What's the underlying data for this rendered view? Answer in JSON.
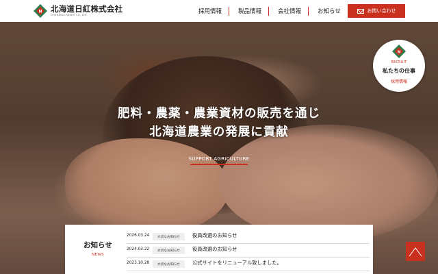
{
  "header": {
    "company_name": "北海道日紅株式会社",
    "company_sub": "HOKKAIDO NIKKO CO.,Ltd.",
    "nav": [
      {
        "label": "採用情報"
      },
      {
        "label": "製品情報"
      },
      {
        "label": "会社情報"
      },
      {
        "label": "お知らせ"
      }
    ],
    "contact_label": "お問い合わせ",
    "accent_color": "#c9301f"
  },
  "hero": {
    "catch_line1": "肥料・農薬・農業資材の販売を通じ",
    "catch_line2": "北海道農業の発展に貢献",
    "support_label": "SUPPORT AGRICULTURE"
  },
  "recruit": {
    "label": "RECRUIT",
    "title": "私たちの仕事",
    "sub": "採用情報"
  },
  "news": {
    "heading": "お知らせ",
    "sub": "NEWS",
    "items": [
      {
        "date": "2026.03.24",
        "category": "大切なお知らせ",
        "title": "役員改選のお知らせ"
      },
      {
        "date": "2024.03.22",
        "category": "大切なお知らせ",
        "title": "役員改選のお知らせ"
      },
      {
        "date": "2023.10.28",
        "category": "大切なお知らせ",
        "title": "公式サイトをリニューアル致しました。"
      }
    ]
  }
}
